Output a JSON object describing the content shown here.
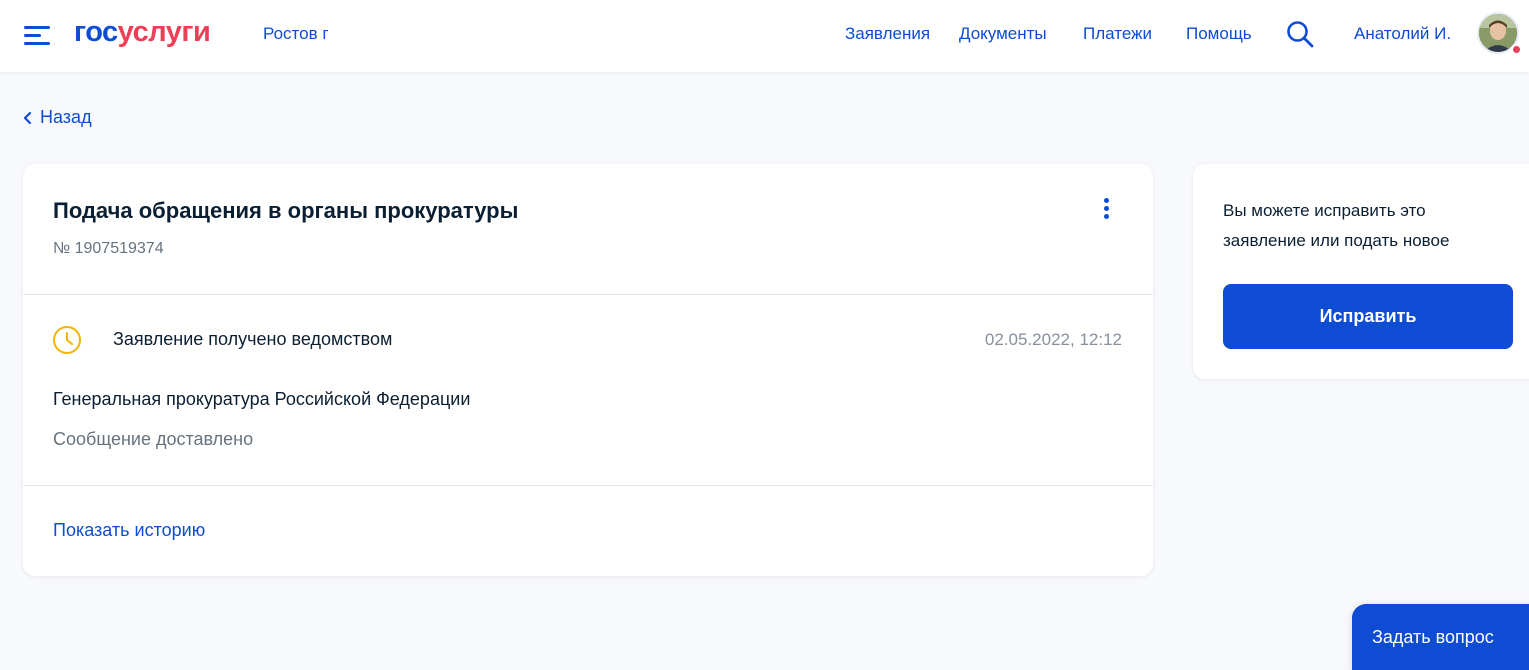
{
  "header": {
    "logo_part1": "гос",
    "logo_part2": "услуги",
    "region": "Ростов г",
    "nav": [
      "Заявления",
      "Документы",
      "Платежи",
      "Помощь"
    ],
    "user_name": "Анатолий И."
  },
  "back_label": "Назад",
  "application": {
    "title": "Подача обращения в органы прокуратуры",
    "number": "№ 1907519374",
    "status": "Заявление получено ведомством",
    "status_date": "02.05.2022, 12:12",
    "agency": "Генеральная прокуратура Российской Федерации",
    "message": "Сообщение доставлено",
    "history_link": "Показать историю"
  },
  "side_panel": {
    "text": "Вы можете исправить это заявление или подать новое",
    "button_label": "Исправить"
  },
  "ask_button_label": "Задать вопрос",
  "colors": {
    "accent": "#0d4cd3",
    "brand_red": "#ee3f58",
    "status_icon": "#f4b400",
    "background": "#f8f9fd"
  },
  "icons": {
    "menu": "menu-icon",
    "search": "search-icon",
    "back": "chevron-left-icon",
    "more": "more-vertical-icon",
    "status": "clock-icon"
  }
}
